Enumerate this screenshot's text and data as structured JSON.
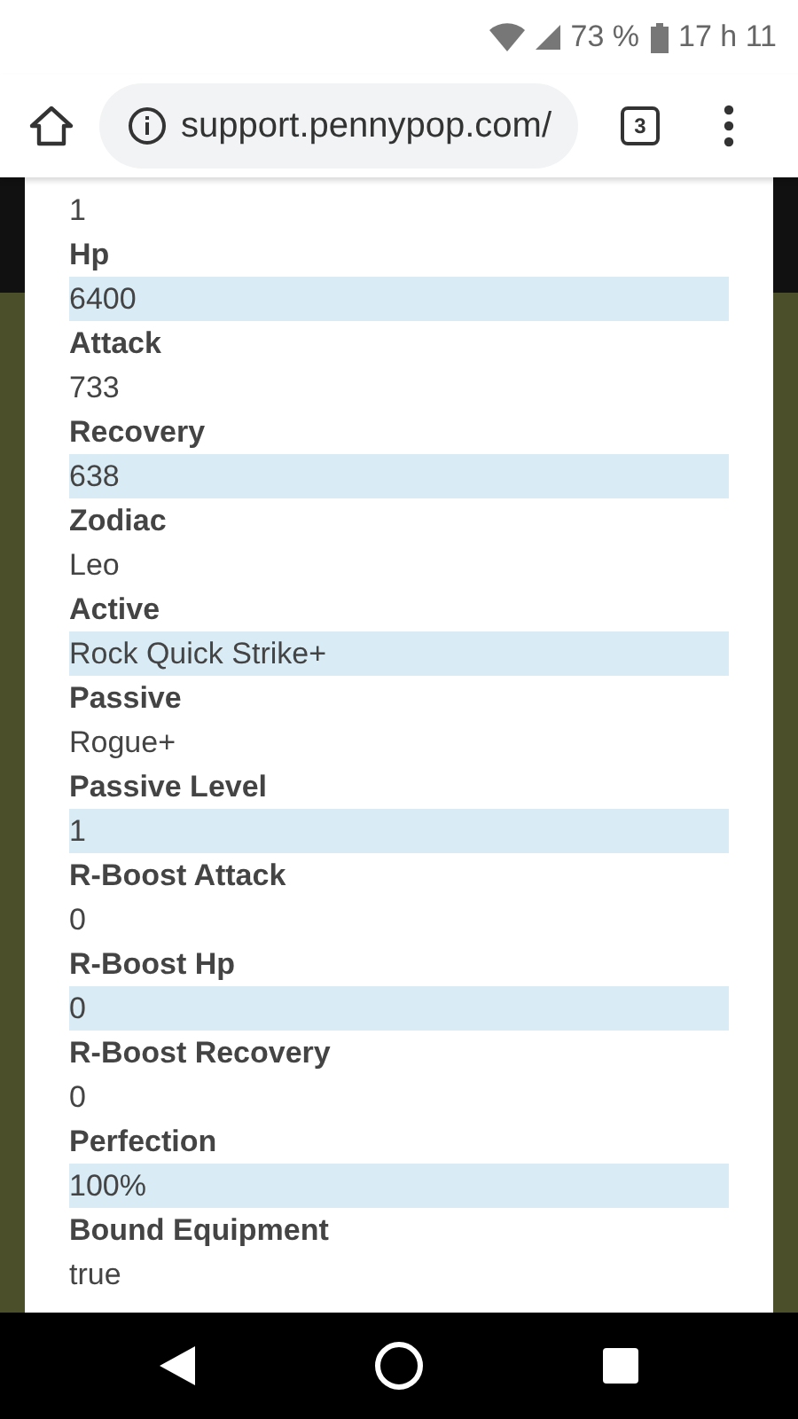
{
  "status_bar": {
    "battery": "73 %",
    "time": "17 h 11"
  },
  "browser": {
    "url": "support.pennypop.com/",
    "tab_count": "3"
  },
  "first_value": "1",
  "fields": [
    {
      "label": "Hp",
      "value": "6400",
      "highlighted": true
    },
    {
      "label": "Attack",
      "value": "733",
      "highlighted": false
    },
    {
      "label": "Recovery",
      "value": "638",
      "highlighted": true
    },
    {
      "label": "Zodiac",
      "value": "Leo",
      "highlighted": false
    },
    {
      "label": "Active",
      "value": "Rock Quick Strike+",
      "highlighted": true
    },
    {
      "label": "Passive",
      "value": "Rogue+",
      "highlighted": false
    },
    {
      "label": "Passive Level",
      "value": "1",
      "highlighted": true
    },
    {
      "label": "R-Boost Attack",
      "value": "0",
      "highlighted": false
    },
    {
      "label": "R-Boost Hp",
      "value": "0",
      "highlighted": true
    },
    {
      "label": "R-Boost Recovery",
      "value": "0",
      "highlighted": false
    },
    {
      "label": "Perfection",
      "value": "100%",
      "highlighted": true
    },
    {
      "label": "Bound Equipment",
      "value": "true",
      "highlighted": false
    }
  ]
}
